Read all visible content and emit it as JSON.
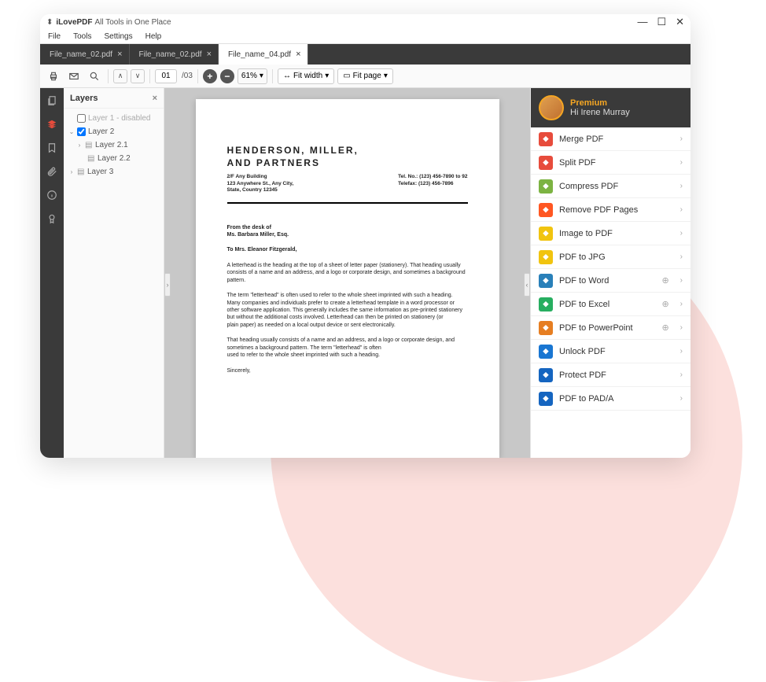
{
  "title": {
    "app": "iLovePDF",
    "tagline": "All Tools in One Place"
  },
  "menu": [
    "File",
    "Tools",
    "Settings",
    "Help"
  ],
  "tabs": [
    {
      "label": "File_name_02.pdf",
      "active": false
    },
    {
      "label": "File_name_02.pdf",
      "active": false
    },
    {
      "label": "File_name_04.pdf",
      "active": true
    }
  ],
  "toolbar": {
    "page_current": "01",
    "page_total": "/03",
    "zoom": "61%",
    "fit_width": "Fit width",
    "fit_page": "Fit page"
  },
  "layers": {
    "title": "Layers",
    "items": [
      {
        "label": "Layer 1 - disabled",
        "depth": 0,
        "checked": false,
        "expandable": false,
        "disabled": true
      },
      {
        "label": "Layer 2",
        "depth": 0,
        "checked": true,
        "expandable": true
      },
      {
        "label": "Layer 2.1",
        "depth": 1,
        "expandable": true,
        "stack": true
      },
      {
        "label": "Layer 2.2",
        "depth": 2,
        "stack": true
      },
      {
        "label": "Layer 3",
        "depth": 0,
        "expandable": true,
        "stack": true
      }
    ]
  },
  "doc": {
    "heading_l1": "HENDERSON, MILLER,",
    "heading_l2": "AND PARTNERS",
    "addr_l1": "2/F Any Building",
    "addr_l2": "123 Anywhere St., Any City,",
    "addr_l3": "State, Country 12345",
    "tel1": "Tel. No.: (123) 456-7890 to 92",
    "tel2": "Telefax: (123) 456-7896",
    "from1": "From the desk of",
    "from2": "Ms. Barbara Miller, Esq.",
    "to": "To Mrs. Eleanor Fitzgerald,",
    "p1": "A letterhead is the heading at the top of a sheet of letter paper (stationery). That heading usually consists of a name and an address, and a logo or corporate design, and sometimes a background pattern.",
    "p2": "The term \"letterhead\" is often used to refer to the whole sheet imprinted with such a heading. Many companies and individuals prefer to create a letterhead template in a word processor or other software application. This generally includes the same information as pre-printed stationery but without the additional costs involved. Letterhead can then be printed on stationery (or",
    "p3": "plain paper) as needed on a local output device or sent electronically.",
    "p4": "That heading usually consists of a name and an address, and a logo or corporate design, and sometimes a background pattern. The term \"letterhead\" is often",
    "p5": "used to refer to the whole sheet imprinted with such a heading.",
    "signoff": "Sincerely,"
  },
  "user": {
    "premium": "Premium",
    "greeting": "Hi Irene Murray"
  },
  "tools": [
    {
      "label": "Merge PDF",
      "color": "#e74c3c"
    },
    {
      "label": "Split PDF",
      "color": "#e74c3c"
    },
    {
      "label": "Compress PDF",
      "color": "#7cb342"
    },
    {
      "label": "Remove PDF Pages",
      "color": "#ff5722"
    },
    {
      "label": "Image to PDF",
      "color": "#f1c40f"
    },
    {
      "label": "PDF to JPG",
      "color": "#f1c40f"
    },
    {
      "label": "PDF to Word",
      "color": "#2980b9",
      "globe": true
    },
    {
      "label": "PDF to Excel",
      "color": "#27ae60",
      "globe": true
    },
    {
      "label": "PDF to PowerPoint",
      "color": "#e67e22",
      "globe": true
    },
    {
      "label": "Unlock PDF",
      "color": "#1976d2"
    },
    {
      "label": "Protect PDF",
      "color": "#1565c0"
    },
    {
      "label": "PDF to PAD/A",
      "color": "#1565c0"
    }
  ]
}
